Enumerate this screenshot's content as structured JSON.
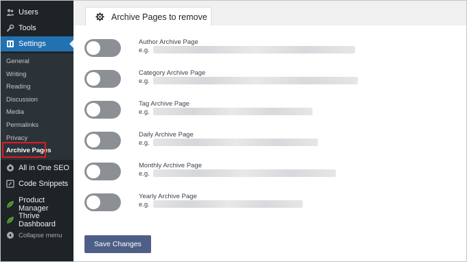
{
  "sidebar": {
    "top_items": [
      {
        "label": "Users",
        "icon": "users-icon"
      },
      {
        "label": "Tools",
        "icon": "wrench-icon"
      },
      {
        "label": "Settings",
        "icon": "settings-icon"
      }
    ],
    "submenu": [
      {
        "label": "General"
      },
      {
        "label": "Writing"
      },
      {
        "label": "Reading"
      },
      {
        "label": "Discussion"
      },
      {
        "label": "Media"
      },
      {
        "label": "Permalinks"
      },
      {
        "label": "Privacy"
      },
      {
        "label": "Archive Pages"
      }
    ],
    "plugins": [
      {
        "label": "All in One SEO",
        "icon": "aioseo-icon"
      },
      {
        "label": "Code Snippets",
        "icon": "code-snippets-icon"
      },
      {
        "label": "Product Manager",
        "icon": "leaf-icon"
      },
      {
        "label": "Thrive Dashboard",
        "icon": "leaf-icon"
      }
    ],
    "collapse_label": "Collapse menu",
    "accent_color": "#2271b1",
    "highlight_color": "#e11b22"
  },
  "main": {
    "tab_label": "Archive Pages to remove",
    "rows": [
      {
        "title": "Author Archive Page",
        "eg": "e.g."
      },
      {
        "title": "Category Archive Page",
        "eg": "e.g."
      },
      {
        "title": "Tag Archive Page",
        "eg": "e.g."
      },
      {
        "title": "Daily Archive Page",
        "eg": "e.g."
      },
      {
        "title": "Monthly Archive Page",
        "eg": "e.g."
      },
      {
        "title": "Yearly Archive Page",
        "eg": "e.g."
      }
    ],
    "toggles_on": [
      false,
      false,
      false,
      false,
      false,
      false
    ],
    "save_label": "Save Changes",
    "button_color": "#4e5f87"
  }
}
